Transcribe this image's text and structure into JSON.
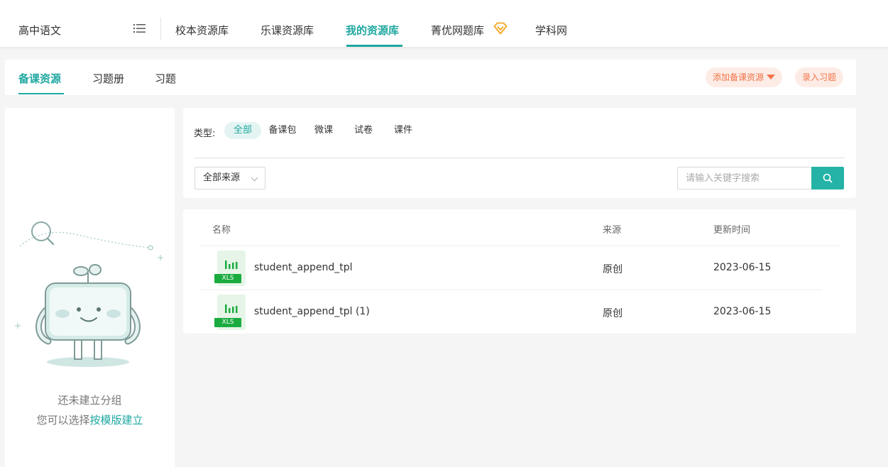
{
  "header": {
    "subject": "高中语文",
    "nav": [
      {
        "label": "校本资源库",
        "active": false
      },
      {
        "label": "乐课资源库",
        "active": false
      },
      {
        "label": "我的资源库",
        "active": true
      },
      {
        "label": "菁优网题库",
        "active": false,
        "badge_icon": "diamond-icon"
      },
      {
        "label": "学科网",
        "active": false
      }
    ]
  },
  "subtabs": {
    "tabs": [
      {
        "label": "备课资源",
        "active": true
      },
      {
        "label": "习题册",
        "active": false
      },
      {
        "label": "习题",
        "active": false
      }
    ],
    "add_button": "添加备课资源",
    "enter_button": "录入习题"
  },
  "left_panel": {
    "empty_text": "还未建立分组",
    "hint_prefix": "您可以选择",
    "hint_link": "按模版建立"
  },
  "filter": {
    "type_label": "类型:",
    "types": [
      {
        "label": "全部",
        "active": true
      },
      {
        "label": "备课包",
        "active": false
      },
      {
        "label": "微课",
        "active": false
      },
      {
        "label": "试卷",
        "active": false
      },
      {
        "label": "课件",
        "active": false
      }
    ],
    "source_select": "全部来源",
    "search_placeholder": "请输入关键字搜索"
  },
  "table": {
    "columns": [
      "名称",
      "来源",
      "更新时间"
    ],
    "rows": [
      {
        "file_type": "XLS",
        "name": "student_append_tpl",
        "source": "原创",
        "updated": "2023-06-15"
      },
      {
        "file_type": "XLS",
        "name": "student_append_tpl (1)",
        "source": "原创",
        "updated": "2023-06-15"
      }
    ]
  },
  "colors": {
    "accent": "#1fa8a0",
    "search_button": "#24b3a6",
    "orange": "#f0754a",
    "pill_bg": "#fdece6",
    "xls_green": "#1aab3f",
    "vip_gold": "#f5a623"
  }
}
